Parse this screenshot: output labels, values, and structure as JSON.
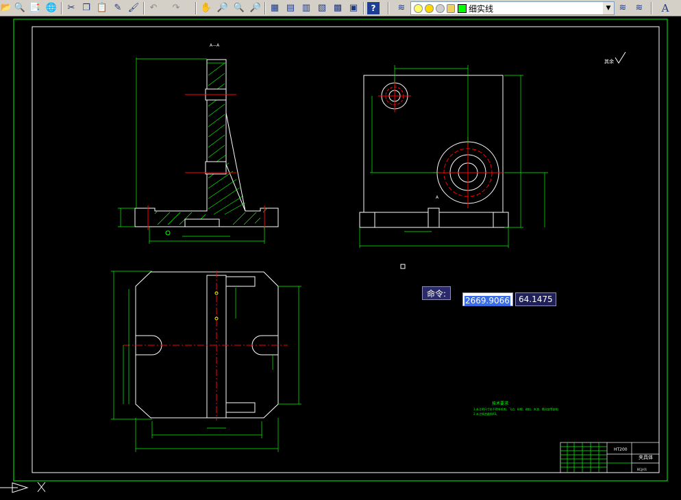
{
  "toolbar": {
    "icons": [
      "open-icon",
      "plot-preview-icon",
      "publish-icon",
      "globe-icon",
      "cut-icon",
      "copy-icon",
      "paste-icon",
      "match-properties-icon",
      "brush-icon",
      "undo-icon",
      "redo-icon",
      "pan-icon",
      "zoom-realtime-icon",
      "zoom-window-icon",
      "zoom-previous-icon",
      "properties-icon",
      "design-center-icon",
      "tool-palettes-icon",
      "sheet-set-icon",
      "markup-icon",
      "calculator-icon",
      "help-icon",
      "layer-manager-icon",
      "layer-previous-icon",
      "text-style-icon"
    ],
    "layer_name": "细实线"
  },
  "drawing": {
    "section_label": "A—A",
    "roughness_label": "其余",
    "section_mark": "A",
    "tech_title": "技术要求",
    "tech_line1": "1.未注明尺寸处不得有毛刺、飞边、砂眼、疏松、夹渣、氧化皮等缺陷",
    "tech_line2": "2.未注铸造圆角R3。",
    "title_material": "HT200",
    "title_part": "夹具体",
    "title_code": "BCJJ-01"
  },
  "command": {
    "label": "命令:",
    "x_value": "2669.9066",
    "y_value": "64.1475"
  },
  "colors": {
    "outline": "#ffffff",
    "dimension": "#00ff00",
    "centerline": "#ff0000",
    "hatch": "#00ff00",
    "cyan": "#00ffff",
    "background": "#000000"
  }
}
